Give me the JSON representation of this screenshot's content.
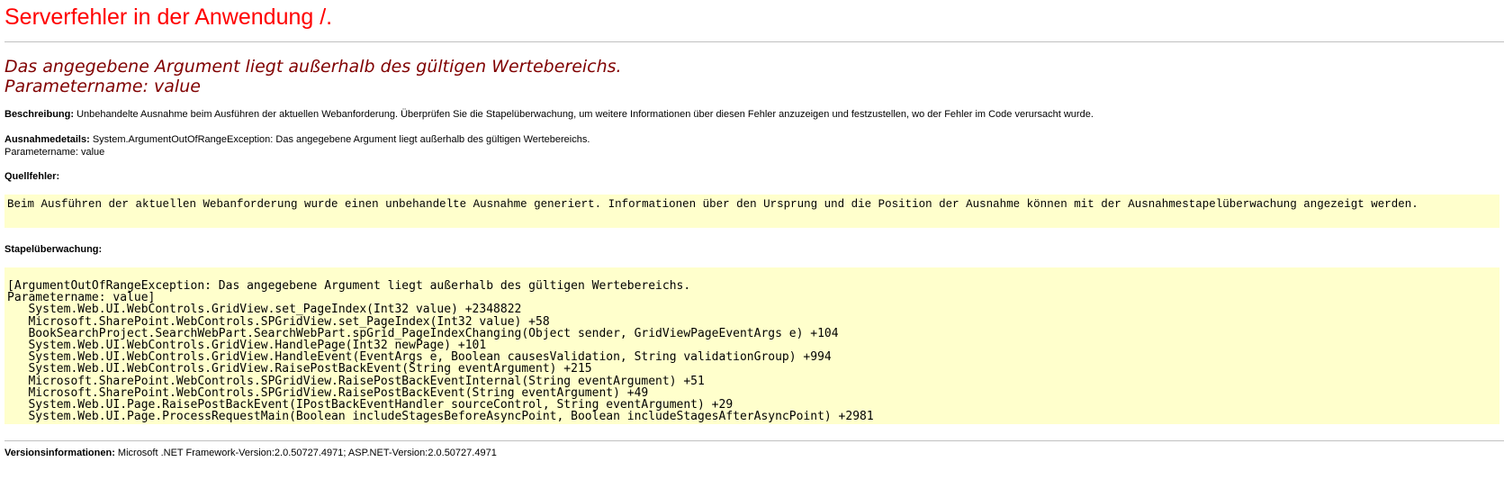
{
  "header": {
    "title": "Serverfehler in der Anwendung /."
  },
  "error": {
    "message_line1": "Das angegebene Argument liegt außerhalb des gültigen Wertebereichs.",
    "message_line2": "Parametername: value"
  },
  "description": {
    "label": "Beschreibung:",
    "text": "Unbehandelte Ausnahme beim Ausführen der aktuellen Webanforderung. Überprüfen Sie die Stapelüberwachung, um weitere Informationen über diesen Fehler anzuzeigen und festzustellen, wo der Fehler im Code verursacht wurde."
  },
  "exception_details": {
    "label": "Ausnahmedetails:",
    "text": "System.ArgumentOutOfRangeException: Das angegebene Argument liegt außerhalb des gültigen Wertebereichs.",
    "param": "Parametername: value"
  },
  "source_error": {
    "label": "Quellfehler:",
    "text": "Beim Ausführen der aktuellen Webanforderung wurde einen unbehandelte Ausnahme generiert. Informationen über den Ursprung und die Position der Ausnahme können mit der Ausnahmestapelüberwachung angezeigt werden."
  },
  "stack_trace": {
    "label": "Stapelüberwachung:",
    "lines": [
      "[ArgumentOutOfRangeException: Das angegebene Argument liegt außerhalb des gültigen Wertebereichs.",
      "Parametername: value]",
      "   System.Web.UI.WebControls.GridView.set_PageIndex(Int32 value) +2348822",
      "   Microsoft.SharePoint.WebControls.SPGridView.set_PageIndex(Int32 value) +58",
      "   BookSearchProject.SearchWebPart.SearchWebPart.spGrid_PageIndexChanging(Object sender, GridViewPageEventArgs e) +104",
      "   System.Web.UI.WebControls.GridView.HandlePage(Int32 newPage) +101",
      "   System.Web.UI.WebControls.GridView.HandleEvent(EventArgs e, Boolean causesValidation, String validationGroup) +994",
      "   System.Web.UI.WebControls.GridView.RaisePostBackEvent(String eventArgument) +215",
      "   Microsoft.SharePoint.WebControls.SPGridView.RaisePostBackEventInternal(String eventArgument) +51",
      "   Microsoft.SharePoint.WebControls.SPGridView.RaisePostBackEvent(String eventArgument) +49",
      "   System.Web.UI.Page.RaisePostBackEvent(IPostBackEventHandler sourceControl, String eventArgument) +29",
      "   System.Web.UI.Page.ProcessRequestMain(Boolean includeStagesBeforeAsyncPoint, Boolean includeStagesAfterAsyncPoint) +2981"
    ]
  },
  "version": {
    "label": "Versionsinformationen:",
    "text": "Microsoft .NET Framework-Version:2.0.50727.4971; ASP.NET-Version:2.0.50727.4971"
  },
  "colors": {
    "title": "#ff0000",
    "message": "#800000",
    "code_background": "#ffffcc"
  }
}
